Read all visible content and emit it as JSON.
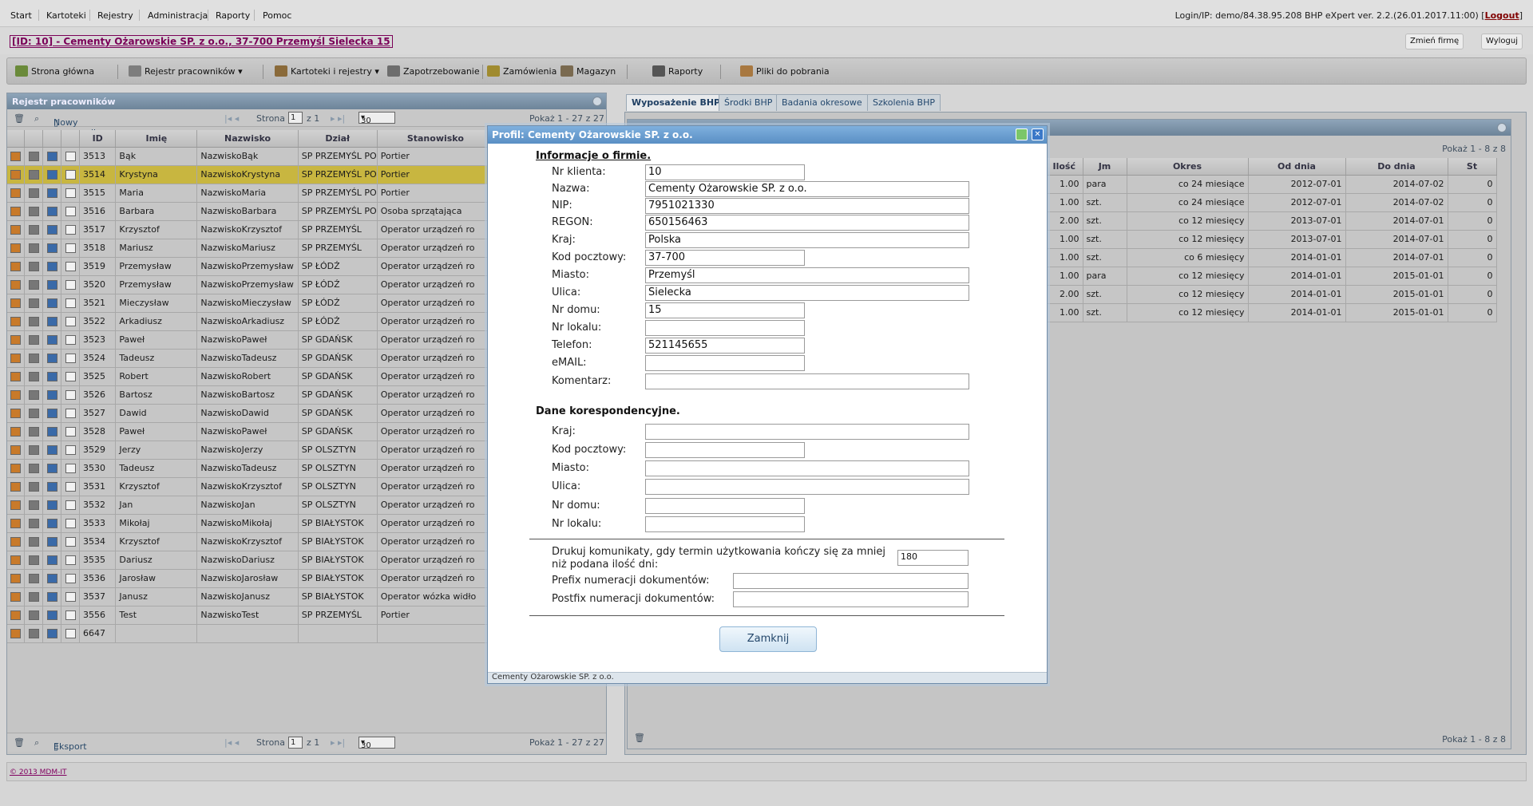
{
  "menu": {
    "items": [
      "Start",
      "Kartoteki",
      "Rejestry",
      "Administracja",
      "Raporty",
      "Pomoc"
    ],
    "login_text": "Login/IP: demo/84.38.95.208 BHP eXpert ver. 2.2.(26.01.2017.11:00) [",
    "logout": "Logout",
    "login_end": "]"
  },
  "company": {
    "link": "[ID: 10] - Cementy Ożarowskie SP. z o.o., 37-700 Przemyśl Sielecka 15",
    "change_btn": "Zmień firmę",
    "logout_btn": "Wyloguj"
  },
  "toolbar": {
    "home": "Strona główna",
    "registry": "Rejestr pracowników",
    "files": "Kartoteki i rejestry",
    "demand": "Zapotrzebowanie",
    "orders": "Zamówienia",
    "warehouse": "Magazyn",
    "reports": "Raporty",
    "downloads": "Pliki do pobrania"
  },
  "left_panel": {
    "title": "Rejestr pracowników",
    "new_employee": "Nowy pracownik",
    "page_label": "Strona",
    "page_num": "1",
    "page_of": "z 1",
    "per_page": "30",
    "show": "Pokaż 1 - 27 z 27",
    "export": "Eksport",
    "columns": [
      "ID",
      "Imię",
      "Nazwisko",
      "Dział",
      "Stanowisko"
    ],
    "rows": [
      [
        "3513",
        "Bąk",
        "NazwiskoBąk",
        "SP PRZEMYŚL PO",
        "Portier"
      ],
      [
        "3514",
        "Krystyna",
        "NazwiskoKrystyna",
        "SP PRZEMYŚL PO",
        "Portier"
      ],
      [
        "3515",
        "Maria",
        "NazwiskoMaria",
        "SP PRZEMYŚL PO",
        "Portier"
      ],
      [
        "3516",
        "Barbara",
        "NazwiskoBarbara",
        "SP PRZEMYŚL PO",
        "Osoba sprzątająca"
      ],
      [
        "3517",
        "Krzysztof",
        "NazwiskoKrzysztof",
        "SP PRZEMYŚL",
        "Operator urządzeń ro"
      ],
      [
        "3518",
        "Mariusz",
        "NazwiskoMariusz",
        "SP PRZEMYŚL",
        "Operator urządzeń ro"
      ],
      [
        "3519",
        "Przemysław",
        "NazwiskoPrzemysław",
        "SP ŁÓDŹ",
        "Operator urządzeń ro"
      ],
      [
        "3520",
        "Przemysław",
        "NazwiskoPrzemysław",
        "SP ŁÓDŹ",
        "Operator urządzeń ro"
      ],
      [
        "3521",
        "Mieczysław",
        "NazwiskoMieczysław",
        "SP ŁÓDŹ",
        "Operator urządzeń ro"
      ],
      [
        "3522",
        "Arkadiusz",
        "NazwiskoArkadiusz",
        "SP ŁÓDŹ",
        "Operator urządzeń ro"
      ],
      [
        "3523",
        "Paweł",
        "NazwiskoPaweł",
        "SP GDAŃSK",
        "Operator urządzeń ro"
      ],
      [
        "3524",
        "Tadeusz",
        "NazwiskoTadeusz",
        "SP GDAŃSK",
        "Operator urządzeń ro"
      ],
      [
        "3525",
        "Robert",
        "NazwiskoRobert",
        "SP GDAŃSK",
        "Operator urządzeń ro"
      ],
      [
        "3526",
        "Bartosz",
        "NazwiskoBartosz",
        "SP GDAŃSK",
        "Operator urządzeń ro"
      ],
      [
        "3527",
        "Dawid",
        "NazwiskoDawid",
        "SP GDAŃSK",
        "Operator urządzeń ro"
      ],
      [
        "3528",
        "Paweł",
        "NazwiskoPaweł",
        "SP GDAŃSK",
        "Operator urządzeń ro"
      ],
      [
        "3529",
        "Jerzy",
        "NazwiskoJerzy",
        "SP OLSZTYN",
        "Operator urządzeń ro"
      ],
      [
        "3530",
        "Tadeusz",
        "NazwiskoTadeusz",
        "SP OLSZTYN",
        "Operator urządzeń ro"
      ],
      [
        "3531",
        "Krzysztof",
        "NazwiskoKrzysztof",
        "SP OLSZTYN",
        "Operator urządzeń ro"
      ],
      [
        "3532",
        "Jan",
        "NazwiskoJan",
        "SP OLSZTYN",
        "Operator urządzeń ro"
      ],
      [
        "3533",
        "Mikołaj",
        "NazwiskoMikołaj",
        "SP BIAŁYSTOK",
        "Operator urządzeń ro"
      ],
      [
        "3534",
        "Krzysztof",
        "NazwiskoKrzysztof",
        "SP BIAŁYSTOK",
        "Operator urządzeń ro"
      ],
      [
        "3535",
        "Dariusz",
        "NazwiskoDariusz",
        "SP BIAŁYSTOK",
        "Operator urządzeń ro"
      ],
      [
        "3536",
        "Jarosław",
        "NazwiskoJarosław",
        "SP BIAŁYSTOK",
        "Operator urządzeń ro"
      ],
      [
        "3537",
        "Janusz",
        "NazwiskoJanusz",
        "SP BIAŁYSTOK",
        "Operator wózka widło"
      ],
      [
        "3556",
        "Test",
        "NazwiskoTest",
        "SP PRZEMYŚL",
        "Portier"
      ],
      [
        "6647",
        "",
        "",
        "",
        ""
      ]
    ]
  },
  "right_panel": {
    "tabs": [
      "Wyposażenie BHP",
      "Środki BHP",
      "Badania okresowe",
      "Szkolenia BHP"
    ],
    "show_top": "Pokaż 1 - 8 z 8",
    "show_bottom": "Pokaż 1 - 8 z 8",
    "columns": [
      "Ilość",
      "Jm",
      "Okres",
      "Od dnia",
      "Do dnia",
      "St"
    ],
    "rows": [
      [
        "1.00",
        "para",
        "co 24 miesiące",
        "2012-07-01",
        "2014-07-02",
        "0"
      ],
      [
        "1.00",
        "szt.",
        "co 24 miesiące",
        "2012-07-01",
        "2014-07-02",
        "0"
      ],
      [
        "2.00",
        "szt.",
        "co 12 miesięcy",
        "2013-07-01",
        "2014-07-01",
        "0"
      ],
      [
        "1.00",
        "szt.",
        "co 12 miesięcy",
        "2013-07-01",
        "2014-07-01",
        "0"
      ],
      [
        "1.00",
        "szt.",
        "co 6 miesięcy",
        "2014-01-01",
        "2014-07-01",
        "0"
      ],
      [
        "1.00",
        "para",
        "co 12 miesięcy",
        "2014-01-01",
        "2015-01-01",
        "0"
      ],
      [
        "2.00",
        "szt.",
        "co 12 miesięcy",
        "2014-01-01",
        "2015-01-01",
        "0"
      ],
      [
        "1.00",
        "szt.",
        "co 12 miesięcy",
        "2014-01-01",
        "2015-01-01",
        "0"
      ]
    ]
  },
  "dialog": {
    "title": "Profil: Cementy Ożarowskie SP. z o.o.",
    "section_company": "Informacje o firmie.",
    "fields": [
      {
        "label": "Nr klienta:",
        "value": "10"
      },
      {
        "label": "Nazwa:",
        "value": "Cementy Ożarowskie SP. z o.o."
      },
      {
        "label": "NIP:",
        "value": "7951021330"
      },
      {
        "label": "REGON:",
        "value": "650156463"
      },
      {
        "label": "Kraj:",
        "value": "Polska"
      },
      {
        "label": "Kod pocztowy:",
        "value": "37-700"
      },
      {
        "label": "Miasto:",
        "value": "Przemyśl"
      },
      {
        "label": "Ulica:",
        "value": "Sielecka"
      },
      {
        "label": "Nr domu:",
        "value": "15"
      },
      {
        "label": "Nr lokalu:",
        "value": ""
      },
      {
        "label": "Telefon:",
        "value": "521145655"
      },
      {
        "label": "eMAIL:",
        "value": ""
      },
      {
        "label": "Komentarz:",
        "value": ""
      }
    ],
    "section_corr": "Dane korespondencyjne.",
    "corr_fields": [
      {
        "label": "Kraj:",
        "value": ""
      },
      {
        "label": "Kod pocztowy:",
        "value": ""
      },
      {
        "label": "Miasto:",
        "value": ""
      },
      {
        "label": "Ulica:",
        "value": ""
      },
      {
        "label": "Nr domu:",
        "value": ""
      },
      {
        "label": "Nr lokalu:",
        "value": ""
      }
    ],
    "notify_label_1": "Drukuj komunikaty, gdy termin użytkowania kończy się za mniej",
    "notify_label_2": "niż podana ilość dni:",
    "notify_value": "180",
    "prefix_label": "Prefix numeracji dokumentów:",
    "prefix_value": "",
    "postfix_label": "Postfix numeracji dokumentów:",
    "postfix_value": "",
    "close_btn": "Zamknij",
    "footer": "Cementy Ożarowskie SP. z o.o."
  },
  "footer": {
    "copyright": "© 2013 MDM-IT"
  }
}
